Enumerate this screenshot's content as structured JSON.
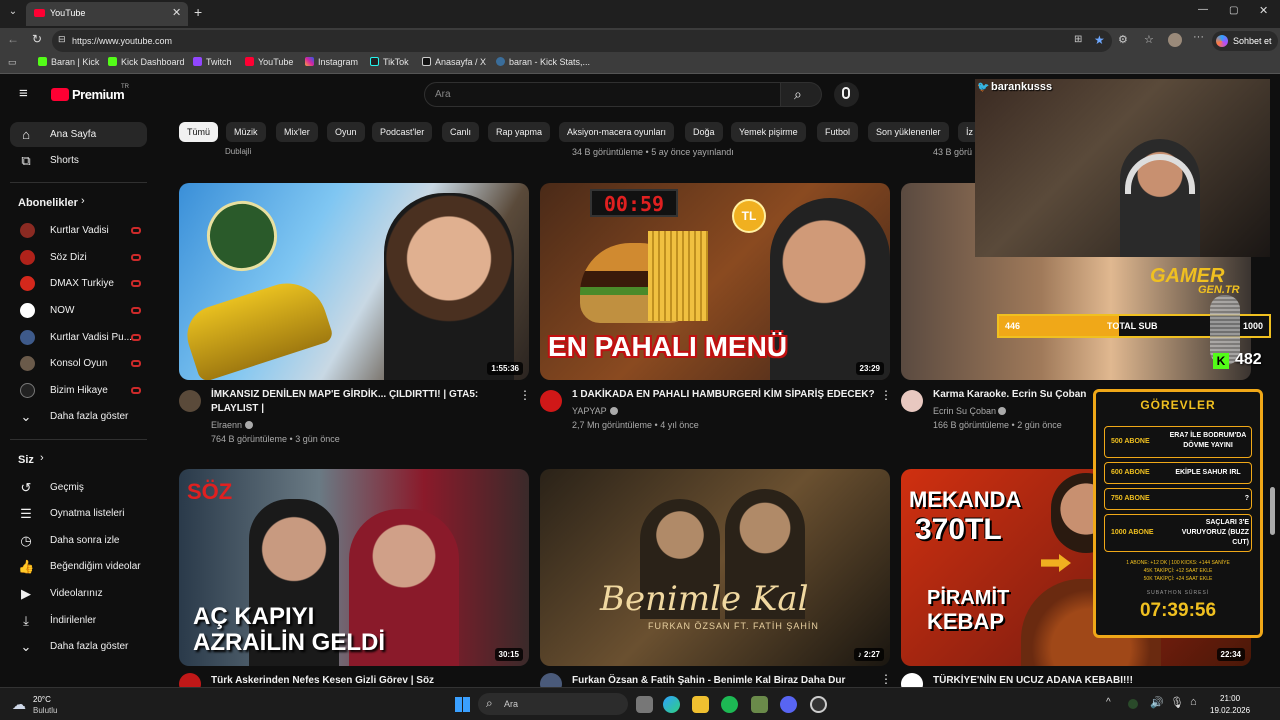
{
  "browser": {
    "tab_title": "YouTube",
    "url": "https://www.youtube.com",
    "copilot_label": "Sohbet et",
    "bookmarks": [
      "Baran | Kick",
      "Kick Dashboard",
      "Twitch",
      "YouTube",
      "Instagram",
      "TikTok",
      "Anasayfa / X",
      "baran - Kick Stats,..."
    ]
  },
  "youtube": {
    "logo_text": "Premium",
    "region": "TR",
    "search_placeholder": "Ara",
    "chips": [
      "Tümü",
      "Müzik",
      "Mix'ler",
      "Oyun",
      "Podcast'ler",
      "Canlı",
      "Rap yapma",
      "Aksiyon-macera oyunları",
      "Doğa",
      "Yemek pişirme",
      "Futbol",
      "Son yüklenenler",
      "İz"
    ],
    "sidebar": {
      "home": "Ana Sayfa",
      "shorts": "Shorts",
      "subscriptions_header": "Abonelikler",
      "subscriptions": [
        "Kurtlar Vadisi",
        "Söz Dizi",
        "DMAX Turkiye",
        "NOW",
        "Kurtlar Vadisi Pu...",
        "Konsol Oyun",
        "Bizim Hikaye"
      ],
      "show_more": "Daha fazla göster",
      "you_header": "Siz",
      "you_items": [
        "Geçmiş",
        "Oynatma listeleri",
        "Daha sonra izle",
        "Beğendiğim videolar",
        "Videolarınız",
        "İndirilenler"
      ],
      "show_more_2": "Daha fazla göster"
    },
    "top_partial": {
      "channel_1": "Dublajli",
      "meta_2": "34 B görüntüleme • 5 ay önce yayınlandı",
      "meta_3": "43 B görü"
    },
    "videos": [
      {
        "title_1": "İMKANSIZ DENİLEN MAP'E GİRDİK... ÇILDIRTTI! | GTA5:",
        "title_2": "PLAYLIST |",
        "channel": "Elraenn",
        "meta": "764 B görüntüleme • 3 gün önce",
        "duration": "1:55:36"
      },
      {
        "title_1": "1 DAKİKADA EN PAHALI HAMBURGERİ KİM SİPARİŞ EDECEK?",
        "title_2": "",
        "channel": "YAPYAP",
        "meta": "2,7 Mn görüntüleme • 4 yıl önce",
        "duration": "23:29",
        "thumb_text": "EN PAHALI MENÜ",
        "timer": "00:59",
        "coin": "TL"
      },
      {
        "title_1": "Karma Karaoke. Ecrin Su Çoban",
        "title_2": "",
        "channel": "Ecrin Su Çoban",
        "meta": "166 B görüntüleme • 2 gün önce",
        "duration": ""
      },
      {
        "title_1": "Türk Askerinden Nefes Kesen Gizli Görev | Söz",
        "channel": "",
        "meta": "",
        "duration": "30:15",
        "thumb_text_1": "AÇ KAPIYI",
        "thumb_text_2": "AZRAİLİN GELDİ",
        "logo": "SÖZ"
      },
      {
        "title_1": "Furkan Özsan & Fatih Şahin - Benimle Kal Biraz Daha Dur",
        "channel": "",
        "meta": "",
        "duration": "2:27",
        "thumb_script": "Benimle Kal",
        "thumb_sub": "FURKAN ÖZSAN FT. FATİH ŞAHİN"
      },
      {
        "title_1": "TÜRKİYE'NİN EN UCUZ ADANA KEBABI!!!",
        "channel": "",
        "meta": "",
        "duration": "22:34",
        "thumb_text_1": "MEKANDA",
        "thumb_text_2": "370TL",
        "thumb_text_3": "PİRAMİT",
        "thumb_text_4": "KEBAP"
      }
    ]
  },
  "overlay": {
    "twitter_handle": "barankusss",
    "brand_1": "GAMER",
    "brand_2": "GEN.TR",
    "sub_current": "446",
    "sub_label": "TOTAL SUB",
    "sub_goal": "1000",
    "sub_fraction": 0.446,
    "kick_count": "482",
    "tasks_title": "GÖREVLER",
    "tasks": [
      {
        "goal": "500 ABONE",
        "reward": "ERA7 İLE BODRUM'DA DÖVME YAYINI"
      },
      {
        "goal": "600 ABONE",
        "reward": "EKİPLE SAHUR IRL"
      },
      {
        "goal": "750 ABONE",
        "reward": "?"
      },
      {
        "goal": "1000 ABONE",
        "reward": "SAÇLARI 3'E VURUYORUZ (BUZZ CUT)"
      }
    ],
    "rates": [
      "1 ABONE: +12 DK | 100 KICKS: +144 SANİYE",
      "45K TAKİPÇİ: +12 SAAT EKLE",
      "50K TAKİPÇİ: +24 SAAT EKLE"
    ],
    "subathon_label": "SUBATHON SÜRESİ",
    "subathon_time": "07:39:56"
  },
  "taskbar": {
    "temp": "20°C",
    "weather": "Bulutlu",
    "search": "Ara",
    "time": "21:00",
    "date": "19.02.2026"
  }
}
